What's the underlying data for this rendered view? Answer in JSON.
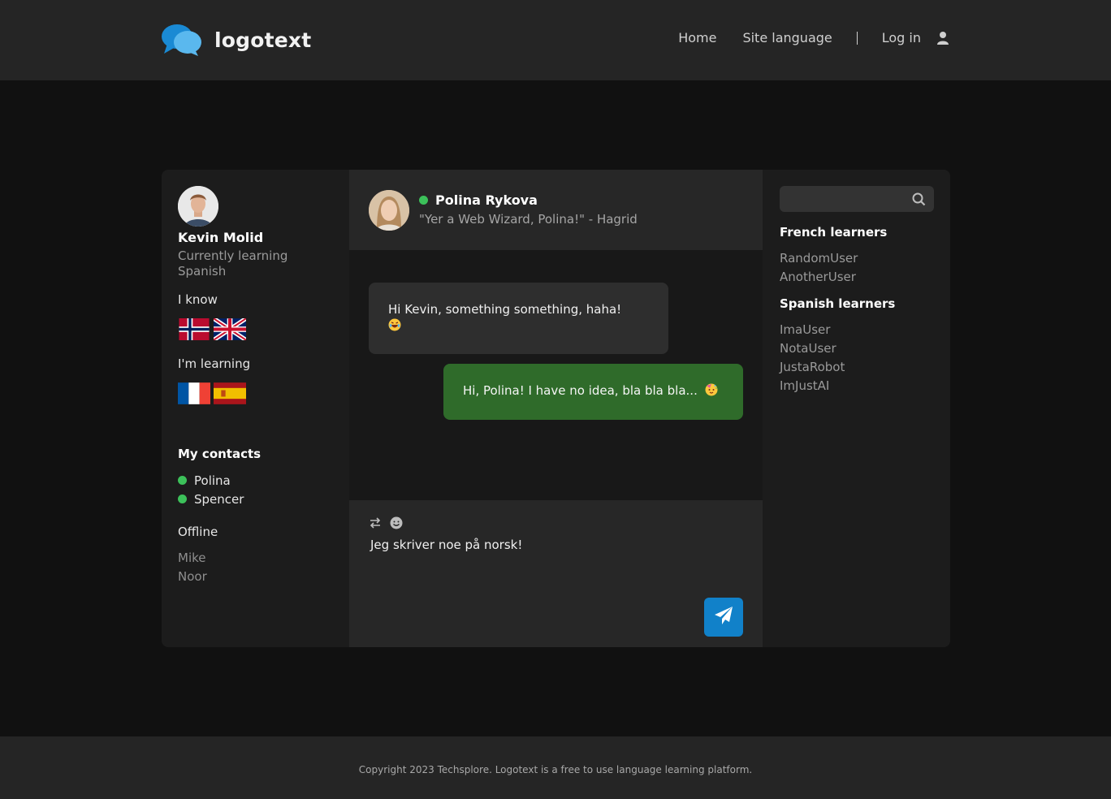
{
  "header": {
    "logo_text": "logotext",
    "nav": {
      "home": "Home",
      "site_language": "Site language",
      "log_in": "Log in"
    }
  },
  "profile": {
    "name": "Kevin Molid",
    "status": "Currently learning Spanish",
    "i_know_label": "I know",
    "known_flags": [
      "norway-flag-icon",
      "uk-flag-icon"
    ],
    "learning_label": "I'm learning",
    "learning_flags": [
      "france-flag-icon",
      "spain-flag-icon"
    ]
  },
  "contacts": {
    "title": "My contacts",
    "online": [
      "Polina",
      "Spencer"
    ],
    "offline_title": "Offline",
    "offline": [
      "Mike",
      "Noor"
    ]
  },
  "chat": {
    "partner_name": "Polina Rykova",
    "partner_quote": "\"Yer a Web Wizard, Polina!\" - Hagrid",
    "messages": [
      {
        "from": "partner",
        "text": "Hi Kevin, something something, haha!"
      },
      {
        "from": "me",
        "text": "Hi, Polina! I have no idea, bla bla bla..."
      }
    ],
    "composer_text": "Jeg skriver noe på norsk!"
  },
  "sidebar": {
    "search_placeholder": "",
    "groups": [
      {
        "title": "French learners",
        "users": [
          "RandomUser",
          "AnotherUser"
        ]
      },
      {
        "title": "Spanish learners",
        "users": [
          "ImaUser",
          "NotaUser",
          "JustaRobot",
          "ImJustAI"
        ]
      }
    ]
  },
  "footer": {
    "text": "Copyright 2023 Techsplore. Logotext is a free to use language learning platform."
  },
  "colors": {
    "online": "#3cc15a",
    "outgoing_bubble": "#2f6b2a",
    "send_button": "#1181c9",
    "logo_blue": "#1a8ad4"
  }
}
